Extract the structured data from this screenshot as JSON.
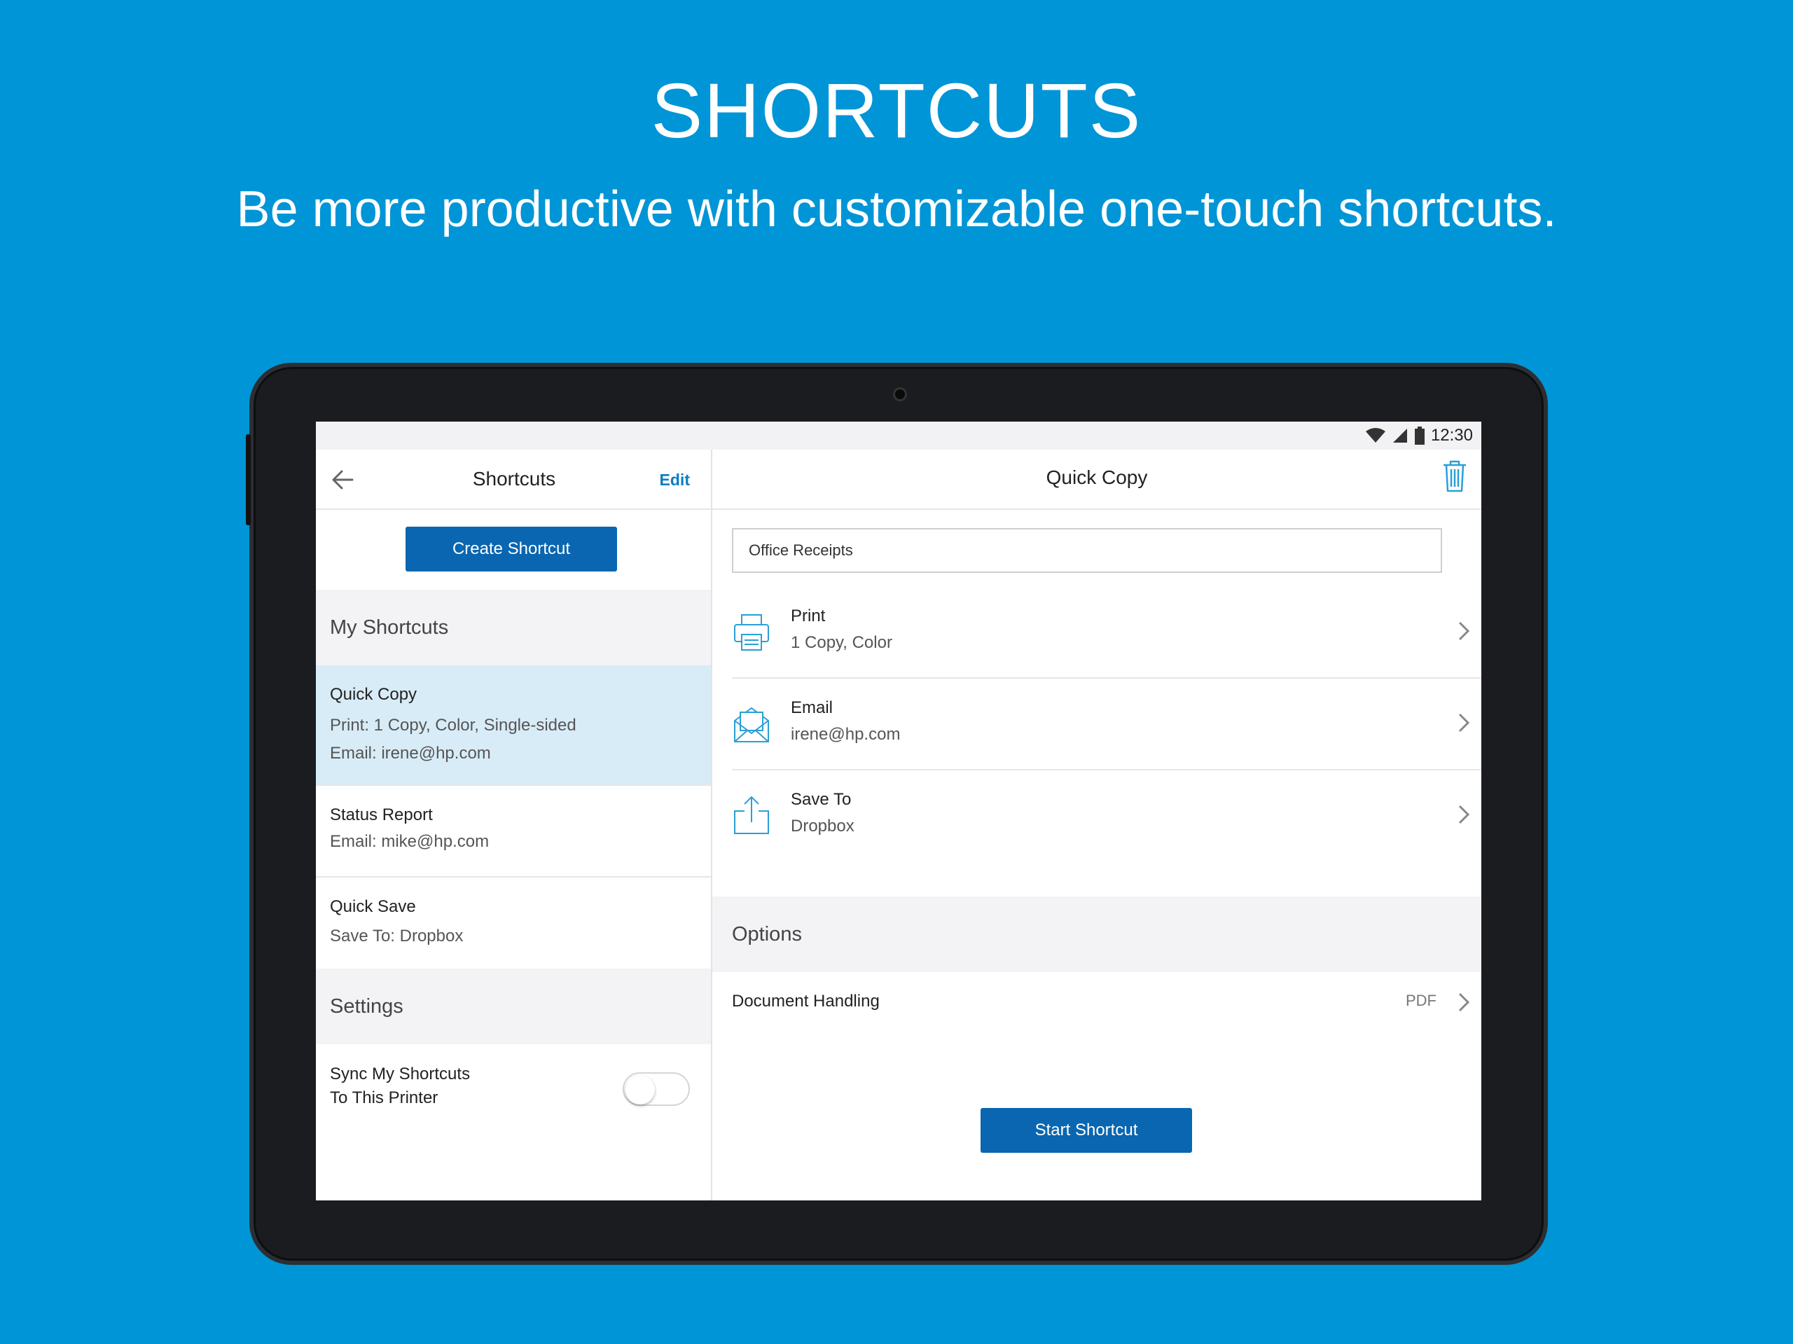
{
  "hero": {
    "title": "SHORTCUTS",
    "subtitle": "Be more productive with customizable one-touch shortcuts."
  },
  "statusbar": {
    "time": "12:30",
    "icons": [
      "wifi-icon",
      "signal-icon",
      "battery-icon"
    ]
  },
  "left_pane": {
    "title": "Shortcuts",
    "edit_label": "Edit",
    "create_button": "Create Shortcut",
    "my_shortcuts_header": "My Shortcuts",
    "shortcuts": [
      {
        "name": "Quick Copy",
        "details": [
          "Print: 1 Copy, Color, Single-sided",
          "Email: irene@hp.com"
        ],
        "selected": true
      },
      {
        "name": "Status Report",
        "details": [
          "Email: mike@hp.com"
        ],
        "selected": false
      },
      {
        "name": "Quick Save",
        "details": [
          "Save To: Dropbox"
        ],
        "selected": false
      }
    ],
    "settings_header": "Settings",
    "sync_label_line1": "Sync My Shortcuts",
    "sync_label_line2": "To This Printer",
    "sync_enabled": false
  },
  "right_pane": {
    "title": "Quick Copy",
    "name_field_value": "Office Receipts",
    "actions": [
      {
        "name": "Print",
        "value": "1 Copy, Color",
        "icon": "printer-icon"
      },
      {
        "name": "Email",
        "value": "irene@hp.com",
        "icon": "envelope-icon"
      },
      {
        "name": "Save To",
        "value": "Dropbox",
        "icon": "share-upload-icon"
      }
    ],
    "options_header": "Options",
    "document_handling_label": "Document Handling",
    "document_handling_value": "PDF",
    "start_button": "Start Shortcut"
  },
  "colors": {
    "background": "#0095d6",
    "accent": "#0a66b0",
    "link": "#0a7dc2",
    "selected_row": "#d8ecf7",
    "icon_blue": "#2a9fd8"
  }
}
